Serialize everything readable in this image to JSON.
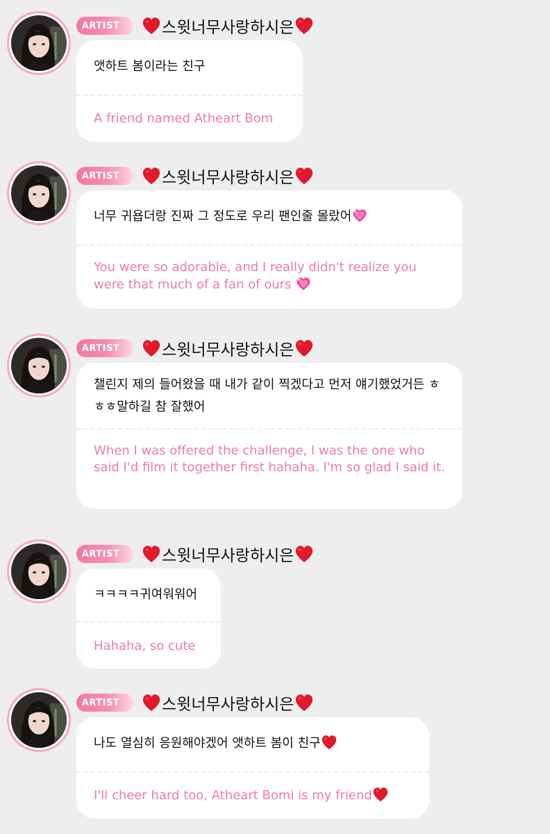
{
  "badge_label": "ARTIST",
  "sender_name": "스윗너무사랑하시은",
  "colors": {
    "background": "#eeeeee",
    "bubble": "#ffffff",
    "translation_text": "#ec7ba6",
    "badge": "#f2779f",
    "heart": "#e0192b"
  },
  "messages": [
    {
      "original": "앳하트 봄이라는 친구",
      "translation": "A friend named Atheart Bom"
    },
    {
      "original": "너무 귀욥더랑 진짜 그 정도로 우리 팬인줄 몰랐어",
      "original_emoji": "sparkling-heart-icon",
      "translation": "You were so adorable, and I really didn't realize you were that much of a fan of ours",
      "translation_emoji": "sparkling-heart-icon"
    },
    {
      "original": "챌린지 제의 들어왔을 때 내가 같이 찍겠다고 먼저 얘기했었거든 ㅎㅎㅎ말하길 참 잘했어",
      "translation": "When I was offered the challenge, I was the one who said I'd film it together first hahaha. I'm so glad I said it."
    },
    {
      "original": "ㅋㅋㅋㅋ귀여워워어",
      "translation": "Hahaha, so cute"
    },
    {
      "original": "나도 열심히 응원해야겠어 앳하트 봄이 친구",
      "original_emoji": "red-heart-icon",
      "translation": "I'll cheer hard too, Atheart Bomi is my friend",
      "translation_emoji": "red-heart-icon"
    }
  ]
}
